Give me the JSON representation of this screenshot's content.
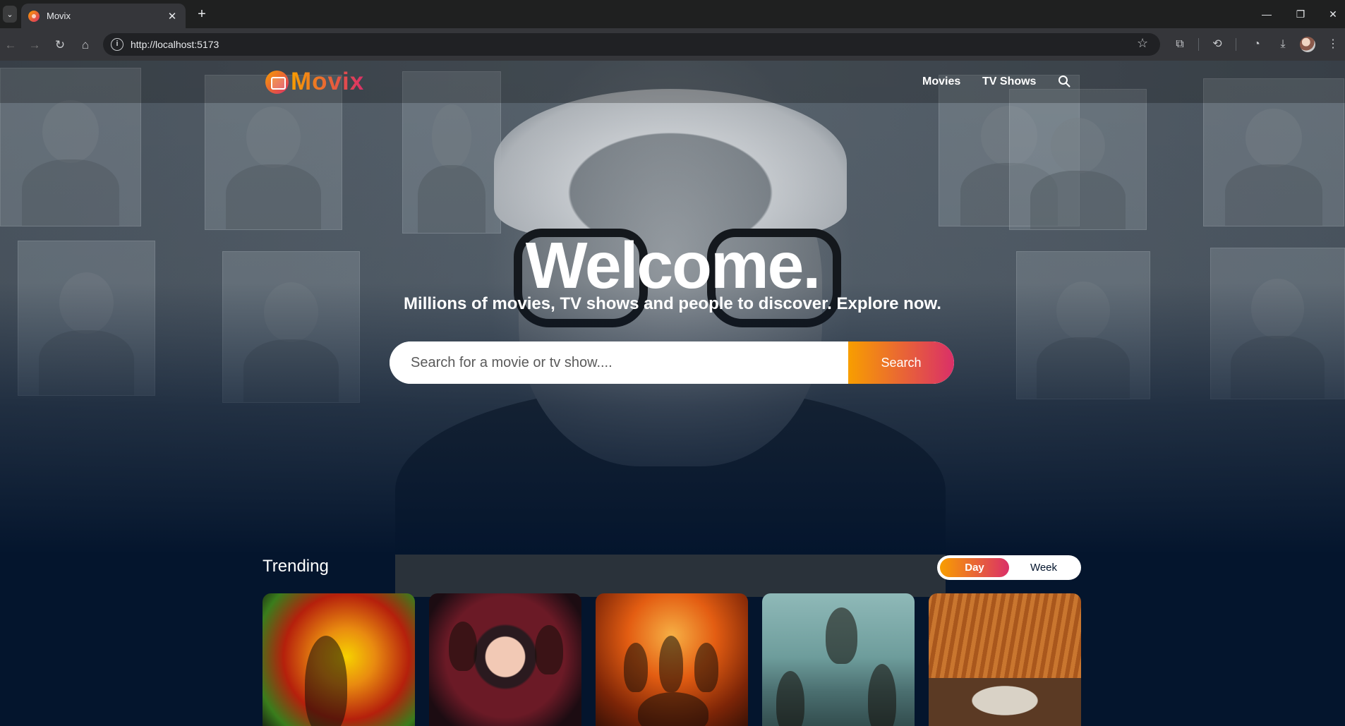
{
  "browser": {
    "tab_title": "Movix",
    "tab_close": "✕",
    "new_tab": "+",
    "tab_list": "⌄",
    "url": "http://localhost:5173",
    "window_controls": {
      "minimize": "—",
      "restore": "❐",
      "close": "✕"
    },
    "nav": {
      "back": "←",
      "forward": "→",
      "reload": "↻",
      "home": "⌂"
    },
    "icons": [
      "star-icon",
      "extensions-icon",
      "history-icon",
      "performance-icon",
      "download-icon",
      "profile-avatar",
      "menu-icon"
    ]
  },
  "header": {
    "logo_text": "Movix",
    "nav_items": [
      "Movies",
      "TV Shows"
    ],
    "search_icon": "search-icon"
  },
  "hero": {
    "title": "Welcome.",
    "subtitle": "Millions of movies, TV shows and people to discover. Explore now.",
    "search_placeholder": "Search for a movie or tv show....",
    "search_button": "Search"
  },
  "trending": {
    "title": "Trending",
    "switch_options": [
      "Day",
      "Week"
    ],
    "selected": "Day",
    "cards": [
      "poster-1",
      "poster-2",
      "poster-3",
      "poster-4",
      "poster-5"
    ]
  },
  "colors": {
    "background": "#04152d",
    "accent_start": "#f89e00",
    "accent_end": "#da2f68"
  }
}
